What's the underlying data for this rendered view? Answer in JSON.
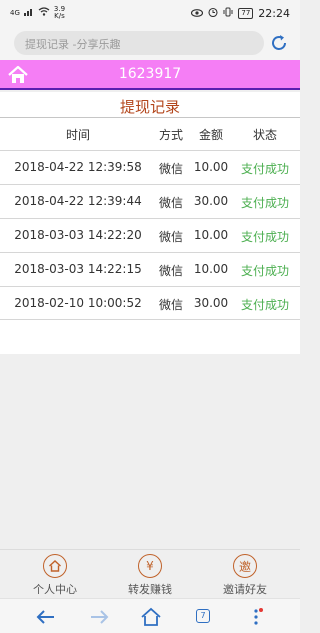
{
  "status_bar": {
    "signal": "4G",
    "speed_value": "3.9",
    "speed_unit": "K/s",
    "battery": "77",
    "time": "22:24"
  },
  "browser": {
    "url_text": "提现记录 -分享乐趣",
    "tab_count": "7"
  },
  "header": {
    "user_id": "1623917"
  },
  "page": {
    "title": "提现记录"
  },
  "table": {
    "headers": [
      "时间",
      "方式",
      "金额",
      "状态"
    ],
    "rows": [
      [
        "2018-04-22 12:39:58",
        "微信",
        "10.00",
        "支付成功"
      ],
      [
        "2018-04-22 12:39:44",
        "微信",
        "30.00",
        "支付成功"
      ],
      [
        "2018-03-03 14:22:20",
        "微信",
        "10.00",
        "支付成功"
      ],
      [
        "2018-03-03 14:22:15",
        "微信",
        "10.00",
        "支付成功"
      ],
      [
        "2018-02-10 10:00:52",
        "微信",
        "30.00",
        "支付成功"
      ]
    ]
  },
  "bottom_tabs": [
    {
      "label": "个人中心",
      "icon": "home-icon"
    },
    {
      "label": "转发赚钱",
      "icon": "yen-icon",
      "glyph": "¥"
    },
    {
      "label": "邀请好友",
      "icon": "invite-icon",
      "glyph": "邀"
    }
  ],
  "colors": {
    "header_bg": "#f57ef5",
    "title": "#b3461c",
    "status_success": "#4caf50",
    "accent": "#2f6fc2"
  }
}
